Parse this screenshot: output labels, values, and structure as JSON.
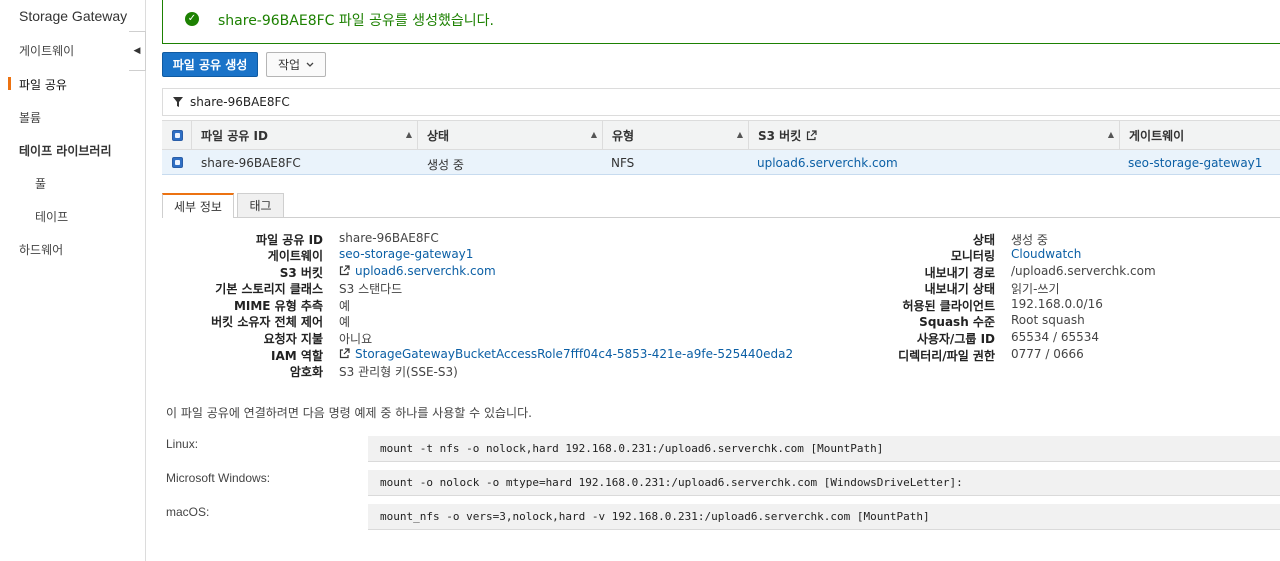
{
  "sidebar": {
    "title": "Storage Gateway",
    "items": [
      {
        "label": "게이트웨이"
      },
      {
        "label": "파일 공유"
      },
      {
        "label": "볼륨"
      },
      {
        "label": "테이프 라이브러리"
      },
      {
        "label": "풀"
      },
      {
        "label": "테이프"
      },
      {
        "label": "하드웨어"
      }
    ],
    "collapse_glyph": "◀"
  },
  "banner": {
    "message": "share-96BAE8FC 파일 공유를 생성했습니다.",
    "color": "#1d8102"
  },
  "toolbar": {
    "create_label": "파일 공유 생성",
    "actions_label": "작업"
  },
  "filter": {
    "value": "share-96BAE8FC"
  },
  "table": {
    "columns": [
      "파일 공유 ID",
      "상태",
      "유형",
      "S3 버킷",
      "게이트웨이"
    ],
    "row": {
      "id": "share-96BAE8FC",
      "status": "생성 중",
      "type": "NFS",
      "bucket": "upload6.serverchk.com",
      "gateway": "seo-storage-gateway1"
    }
  },
  "tabs": [
    "세부 정보",
    "태그"
  ],
  "details_left": [
    {
      "label": "파일 공유 ID",
      "value": "share-96BAE8FC"
    },
    {
      "label": "게이트웨이",
      "value": "seo-storage-gateway1"
    },
    {
      "label": "S3 버킷",
      "value": "upload6.serverchk.com"
    },
    {
      "label": "기본 스토리지 클래스",
      "value": "S3 스탠다드"
    },
    {
      "label": "MIME 유형 추측",
      "value": "예"
    },
    {
      "label": "버킷 소유자 전체 제어",
      "value": "예"
    },
    {
      "label": "요청자 지불",
      "value": "아니요"
    },
    {
      "label": "IAM 역할",
      "value": "StorageGatewayBucketAccessRole7fff04c4-5853-421e-a9fe-525440eda2"
    },
    {
      "label": "암호화",
      "value": "S3 관리형 키(SSE-S3)"
    }
  ],
  "details_right": [
    {
      "label": "상태",
      "value": "생성 중"
    },
    {
      "label": "모니터링",
      "value": "Cloudwatch"
    },
    {
      "label": "내보내기 경로",
      "value": "/upload6.serverchk.com"
    },
    {
      "label": "내보내기 상태",
      "value": "읽기-쓰기"
    },
    {
      "label": "허용된 클라이언트",
      "value": "192.168.0.0/16"
    },
    {
      "label": "Squash 수준",
      "value": "Root squash"
    },
    {
      "label": "사용자/그룹 ID",
      "value": "65534 / 65534"
    },
    {
      "label": "디렉터리/파일 권한",
      "value": "0777 / 0666"
    }
  ],
  "commands": {
    "hint": "이 파일 공유에 연결하려면 다음 명령 예제 중 하나를 사용할 수 있습니다.",
    "linux_label": "Linux:",
    "linux_cmd": "mount -t nfs -o nolock,hard 192.168.0.231:/upload6.serverchk.com [MountPath]",
    "windows_label": "Microsoft Windows:",
    "windows_cmd": "mount -o nolock -o mtype=hard 192.168.0.231:/upload6.serverchk.com [WindowsDriveLetter]:",
    "mac_label": "macOS:",
    "mac_cmd": "mount_nfs -o vers=3,nolock,hard -v 192.168.0.231:/upload6.serverchk.com [MountPath]"
  },
  "colors": {
    "accent": "#ec7211",
    "primary": "#1a73c8",
    "link": "#0b5fa5"
  }
}
